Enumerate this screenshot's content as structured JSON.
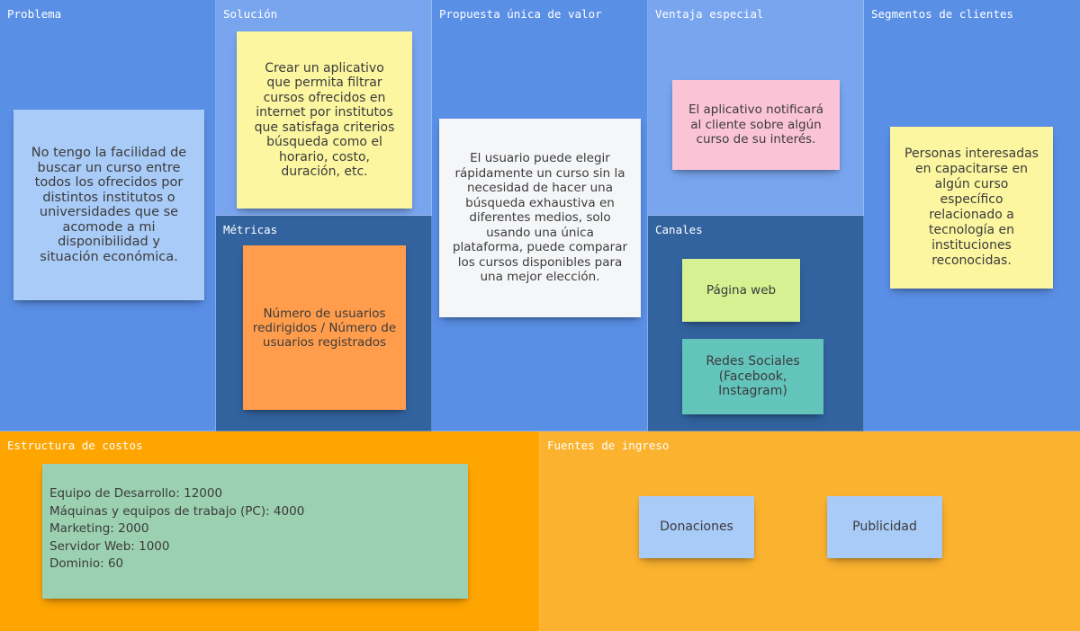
{
  "sections": {
    "problema": {
      "title": "Problema"
    },
    "solucion": {
      "title": "Solución"
    },
    "metricas": {
      "title": "Métricas"
    },
    "propuesta": {
      "title": "Propuesta única de valor"
    },
    "ventaja": {
      "title": "Ventaja especial"
    },
    "canales": {
      "title": "Canales"
    },
    "segmentos": {
      "title": "Segmentos de clientes"
    },
    "costos": {
      "title": "Estructura de costos"
    },
    "ingresos": {
      "title": "Fuentes de ingreso"
    }
  },
  "notes": {
    "problema": {
      "text": "No tengo la facilidad de buscar un curso entre todos los ofrecidos por distintos institutos o universidades que se acomode a mi disponibilidad y situación económica.",
      "color": "#a9cbf7"
    },
    "solucion": {
      "text": "Crear un aplicativo que permita filtrar cursos ofrecidos en internet por institutos\nque satisfaga criterios búsqueda como el horario, costo, duración, etc.",
      "color": "#fbf69f"
    },
    "metricas": {
      "text": "Número de usuarios redirigidos / Número de usuarios registrados",
      "color": "#ff9d4c"
    },
    "propuesta": {
      "text": "El usuario puede  elegir rápidamente un curso sin la necesidad de hacer una búsqueda exhaustiva en diferentes medios, solo usando una única plataforma, puede comparar los cursos disponibles para una mejor elección.",
      "color": "#f5f6f8"
    },
    "ventaja": {
      "text": "El aplicativo notificará al cliente sobre algún curso de su interés.",
      "color": "#fbc4d6"
    },
    "canales_web": {
      "text": "Página web",
      "color": "#d5f191"
    },
    "canales_redes": {
      "text": "Redes Sociales (Facebook, Instagram)",
      "color": "#63c4bc"
    },
    "segmentos": {
      "text": "Personas interesadas en capacitarse en algún curso específico relacionado a tecnología en instituciones reconocidas.",
      "color": "#fbf69f"
    },
    "costos": {
      "text": "Equipo de Desarrollo: 12000\nMáquinas y equipos de trabajo (PC): 4000\nMarketing: 2000\nServidor Web: 1000\nDominio: 60",
      "color": "#9bd0b0"
    },
    "donaciones": {
      "text": "Donaciones",
      "color": "#a9cbf7"
    },
    "publicidad": {
      "text": "Publicidad",
      "color": "#a9cbf7"
    }
  },
  "colors": {
    "section_blue": "#5a8fe6",
    "section_light_blue": "#78a5ee",
    "section_dark_blue": "#32639f",
    "section_orange": "#ffa500",
    "section_light_orange": "#fbb22e"
  }
}
